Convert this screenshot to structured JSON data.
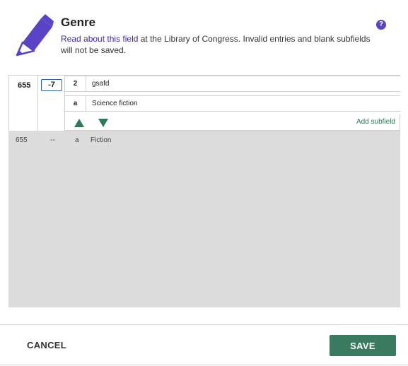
{
  "header": {
    "title": "Genre",
    "link_text": "Read about this field",
    "desc_rest": " at the Library of Congress. Invalid entries and blank subfields will not be saved.",
    "help_glyph": "?"
  },
  "active_field": {
    "tag": "655",
    "indicator": "-7",
    "subfields": [
      {
        "code": "2",
        "value": "gsafd"
      },
      {
        "code": "a",
        "value": "Science fiction"
      }
    ],
    "add_subfield_label": "Add subfield"
  },
  "inactive_field": {
    "tag": "655",
    "indicator": "--",
    "code": "a",
    "value": "Fiction"
  },
  "footer": {
    "cancel_label": "CANCEL",
    "save_label": "SAVE"
  },
  "colors": {
    "accent_purple": "#5b43c8",
    "link": "#3d2ab8",
    "green": "#3a7a5f",
    "indicator_border": "#2f5fa8"
  },
  "icons": {
    "header_icon": "pencil-icon",
    "help_icon": "help-icon",
    "move_up": "arrow-up-icon",
    "move_down": "arrow-down-icon"
  }
}
